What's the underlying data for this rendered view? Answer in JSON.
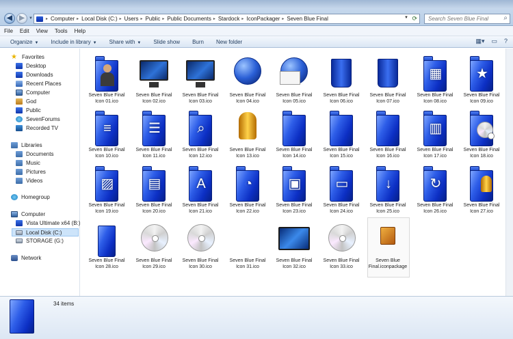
{
  "address": {
    "crumbs": [
      "Computer",
      "Local Disk (C:)",
      "Users",
      "Public",
      "Public Documents",
      "Stardock",
      "IconPackager",
      "Seven Blue Final"
    ]
  },
  "search": {
    "placeholder": "Search Seven Blue Final"
  },
  "menu": {
    "items": [
      "File",
      "Edit",
      "View",
      "Tools",
      "Help"
    ]
  },
  "commands": {
    "organize": "Organize",
    "include": "Include in library",
    "share": "Share with",
    "slideshow": "Slide show",
    "burn": "Burn",
    "newfolder": "New folder"
  },
  "nav": {
    "favorites": "Favorites",
    "desktop": "Desktop",
    "downloads": "Downloads",
    "recent": "Recent Places",
    "computer_fav": "Computer",
    "god": "God",
    "public": "Public",
    "sevenforums": "SevenForums",
    "recordedtv": "Recorded TV",
    "libraries": "Libraries",
    "documents": "Documents",
    "music": "Music",
    "pictures": "Pictures",
    "videos": "Videos",
    "homegroup": "Homegroup",
    "computer": "Computer",
    "vista": "Vista Ultimate x64 (B:)",
    "localdisk": "Local Disk (C:)",
    "storage": "STORAGE (G:)",
    "network": "Network"
  },
  "files": [
    {
      "l1": "Seven Blue Final",
      "l2": "Icon 01.ico",
      "kind": "user"
    },
    {
      "l1": "Seven Blue Final",
      "l2": "Icon 02.ico",
      "kind": "monitor"
    },
    {
      "l1": "Seven Blue Final",
      "l2": "Icon 03.ico",
      "kind": "globe-monitor"
    },
    {
      "l1": "Seven Blue Final",
      "l2": "Icon 04.ico",
      "kind": "globe"
    },
    {
      "l1": "Seven Blue Final",
      "l2": "Icon 05.ico",
      "kind": "globe-mail"
    },
    {
      "l1": "Seven Blue Final",
      "l2": "Icon 06.ico",
      "kind": "bin"
    },
    {
      "l1": "Seven Blue Final",
      "l2": "Icon 07.ico",
      "kind": "bin"
    },
    {
      "l1": "Seven Blue Final",
      "l2": "Icon 08.ico",
      "kind": "panel"
    },
    {
      "l1": "Seven Blue Final",
      "l2": "Icon 09.ico",
      "kind": "star"
    },
    {
      "l1": "Seven Blue Final",
      "l2": "Icon 10.ico",
      "kind": "doc"
    },
    {
      "l1": "Seven Blue Final",
      "l2": "Icon 11.ico",
      "kind": "list"
    },
    {
      "l1": "Seven Blue Final",
      "l2": "Icon 12.ico",
      "kind": "search"
    },
    {
      "l1": "Seven Blue Final",
      "l2": "Icon 13.ico",
      "kind": "trophy"
    },
    {
      "l1": "Seven Blue Final",
      "l2": "Icon 14.ico",
      "kind": "folder"
    },
    {
      "l1": "Seven Blue Final",
      "l2": "Icon 15.ico",
      "kind": "folder"
    },
    {
      "l1": "Seven Blue Final",
      "l2": "Icon 16.ico",
      "kind": "folder"
    },
    {
      "l1": "Seven Blue Final",
      "l2": "Icon 17.ico",
      "kind": "open"
    },
    {
      "l1": "Seven Blue Final",
      "l2": "Icon 18.ico",
      "kind": "disc-folder"
    },
    {
      "l1": "Seven Blue Final",
      "l2": "Icon 19.ico",
      "kind": "picture"
    },
    {
      "l1": "Seven Blue Final",
      "l2": "Icon 20.ico",
      "kind": "film"
    },
    {
      "l1": "Seven Blue Final",
      "l2": "Icon 21.ico",
      "kind": "font"
    },
    {
      "l1": "Seven Blue Final",
      "l2": "Icon 22.ico",
      "kind": "clock"
    },
    {
      "l1": "Seven Blue Final",
      "l2": "Icon 23.ico",
      "kind": "photo"
    },
    {
      "l1": "Seven Blue Final",
      "l2": "Icon 24.ico",
      "kind": "screen"
    },
    {
      "l1": "Seven Blue Final",
      "l2": "Icon 25.ico",
      "kind": "download"
    },
    {
      "l1": "Seven Blue Final",
      "l2": "Icon 26.ico",
      "kind": "refresh"
    },
    {
      "l1": "Seven Blue Final",
      "l2": "Icon 27.ico",
      "kind": "trophy-folder"
    },
    {
      "l1": "Seven Blue Final",
      "l2": "Icon 28.ico",
      "kind": "drive"
    },
    {
      "l1": "Seven Blue Final",
      "l2": "Icon 29.ico",
      "kind": "disc"
    },
    {
      "l1": "Seven Blue Final",
      "l2": "Icon 30.ico",
      "kind": "dvd"
    },
    {
      "l1": "Seven Blue Final",
      "l2": "Icon 31.ico",
      "kind": "blank"
    },
    {
      "l1": "Seven Blue Final",
      "l2": "Icon 32.ico",
      "kind": "widescreen"
    },
    {
      "l1": "Seven Blue Final",
      "l2": "Icon 33.ico",
      "kind": "disc"
    },
    {
      "l1": "Seven Blue",
      "l2": "Final.iconpackage",
      "kind": "package"
    }
  ],
  "details": {
    "count": "34 items"
  },
  "colors": {
    "folder_blue": "#0c2fc4",
    "accent": "#2e5ee8"
  }
}
